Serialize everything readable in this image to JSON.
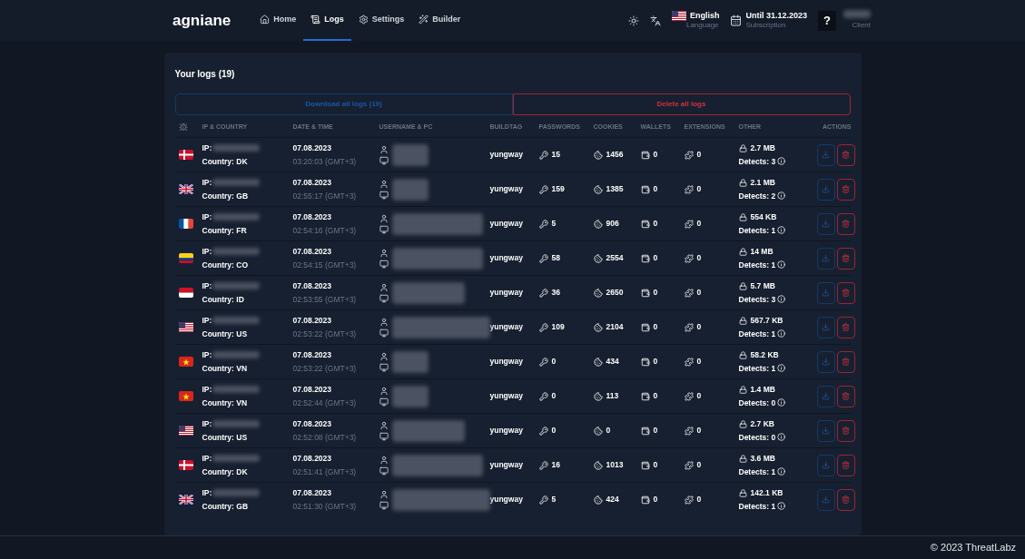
{
  "brand": "agniane",
  "nav": [
    {
      "label": "Home",
      "selected": false
    },
    {
      "label": "Logs",
      "selected": true
    },
    {
      "label": "Settings",
      "selected": false
    },
    {
      "label": "Builder",
      "selected": false
    }
  ],
  "language": {
    "value": "English",
    "caption": "Language"
  },
  "subscription": {
    "value": "Until 31.12.2023",
    "caption": "Subscription"
  },
  "help": "?",
  "client": {
    "caption": "Client"
  },
  "logs": {
    "title": "Your logs (19)",
    "download_all": "Download all logs (19)",
    "delete_all": "Delete all logs",
    "columns": [
      "IP & COUNTRY",
      "DATE & TIME",
      "USERNAME & PC",
      "BUILDTAG",
      "PASSWORDS",
      "COOKIES",
      "WALLETS",
      "EXTENSIONS",
      "OTHER",
      "ACTIONS"
    ],
    "rows": [
      {
        "kind": "dk",
        "ip_label": "IP:",
        "country": "Country: DK",
        "date": "07.08.2023",
        "time": "03:20:03 (GMT+3)",
        "buildtag": "yungway",
        "passwords": "15",
        "cookies": "1456",
        "wallets": "0",
        "extensions": "0",
        "size": "2.7 MB",
        "detects": "Detects: 3"
      },
      {
        "kind": "gb",
        "ip_label": "IP:",
        "country": "Country: GB",
        "date": "07.08.2023",
        "time": "02:55:17 (GMT+3)",
        "buildtag": "yungway",
        "passwords": "159",
        "cookies": "1385",
        "wallets": "0",
        "extensions": "0",
        "size": "2.1 MB",
        "detects": "Detects: 2"
      },
      {
        "kind": "fr",
        "ip_label": "IP:",
        "country": "Country: FR",
        "date": "07.08.2023",
        "time": "02:54:16 (GMT+3)",
        "buildtag": "yungway",
        "passwords": "5",
        "cookies": "906",
        "wallets": "0",
        "extensions": "0",
        "size": "554 KB",
        "detects": "Detects: 1"
      },
      {
        "kind": "co",
        "ip_label": "IP:",
        "country": "Country: CO",
        "date": "07.08.2023",
        "time": "02:54:15 (GMT+3)",
        "buildtag": "yungway",
        "passwords": "58",
        "cookies": "2554",
        "wallets": "0",
        "extensions": "0",
        "size": "14 MB",
        "detects": "Detects: 1"
      },
      {
        "kind": "id",
        "ip_label": "IP:",
        "country": "Country: ID",
        "date": "07.08.2023",
        "time": "02:53:55 (GMT+3)",
        "buildtag": "yungway",
        "passwords": "36",
        "cookies": "2650",
        "wallets": "0",
        "extensions": "0",
        "size": "5.7 MB",
        "detects": "Detects: 3"
      },
      {
        "kind": "us",
        "ip_label": "IP:",
        "country": "Country: US",
        "date": "07.08.2023",
        "time": "02:53:22 (GMT+3)",
        "buildtag": "yungway",
        "passwords": "109",
        "cookies": "2104",
        "wallets": "0",
        "extensions": "0",
        "size": "567.7 KB",
        "detects": "Detects: 1"
      },
      {
        "kind": "vn",
        "ip_label": "IP:",
        "country": "Country: VN",
        "date": "07.08.2023",
        "time": "02:53:22 (GMT+3)",
        "buildtag": "yungway",
        "passwords": "0",
        "cookies": "434",
        "wallets": "0",
        "extensions": "0",
        "size": "58.2 KB",
        "detects": "Detects: 1"
      },
      {
        "kind": "vn",
        "ip_label": "IP:",
        "country": "Country: VN",
        "date": "07.08.2023",
        "time": "02:52:44 (GMT+3)",
        "buildtag": "yungway",
        "passwords": "0",
        "cookies": "113",
        "wallets": "0",
        "extensions": "0",
        "size": "1.4 MB",
        "detects": "Detects: 0"
      },
      {
        "kind": "us",
        "ip_label": "IP:",
        "country": "Country: US",
        "date": "07.08.2023",
        "time": "02:52:08 (GMT+3)",
        "buildtag": "yungway",
        "passwords": "0",
        "cookies": "0",
        "wallets": "0",
        "extensions": "0",
        "size": "2.7 KB",
        "detects": "Detects: 0"
      },
      {
        "kind": "dk",
        "ip_label": "IP:",
        "country": "Country: DK",
        "date": "07.08.2023",
        "time": "02:51:41 (GMT+3)",
        "buildtag": "yungway",
        "passwords": "16",
        "cookies": "1013",
        "wallets": "0",
        "extensions": "0",
        "size": "3.6 MB",
        "detects": "Detects: 1"
      },
      {
        "kind": "gb",
        "ip_label": "IP:",
        "country": "Country: GB",
        "date": "07.08.2023",
        "time": "02:51:30 (GMT+3)",
        "buildtag": "yungway",
        "passwords": "5",
        "cookies": "424",
        "wallets": "0",
        "extensions": "0",
        "size": "142.1 KB",
        "detects": "Detects: 1"
      }
    ]
  },
  "footer": "© 2023 ThreatLabz"
}
